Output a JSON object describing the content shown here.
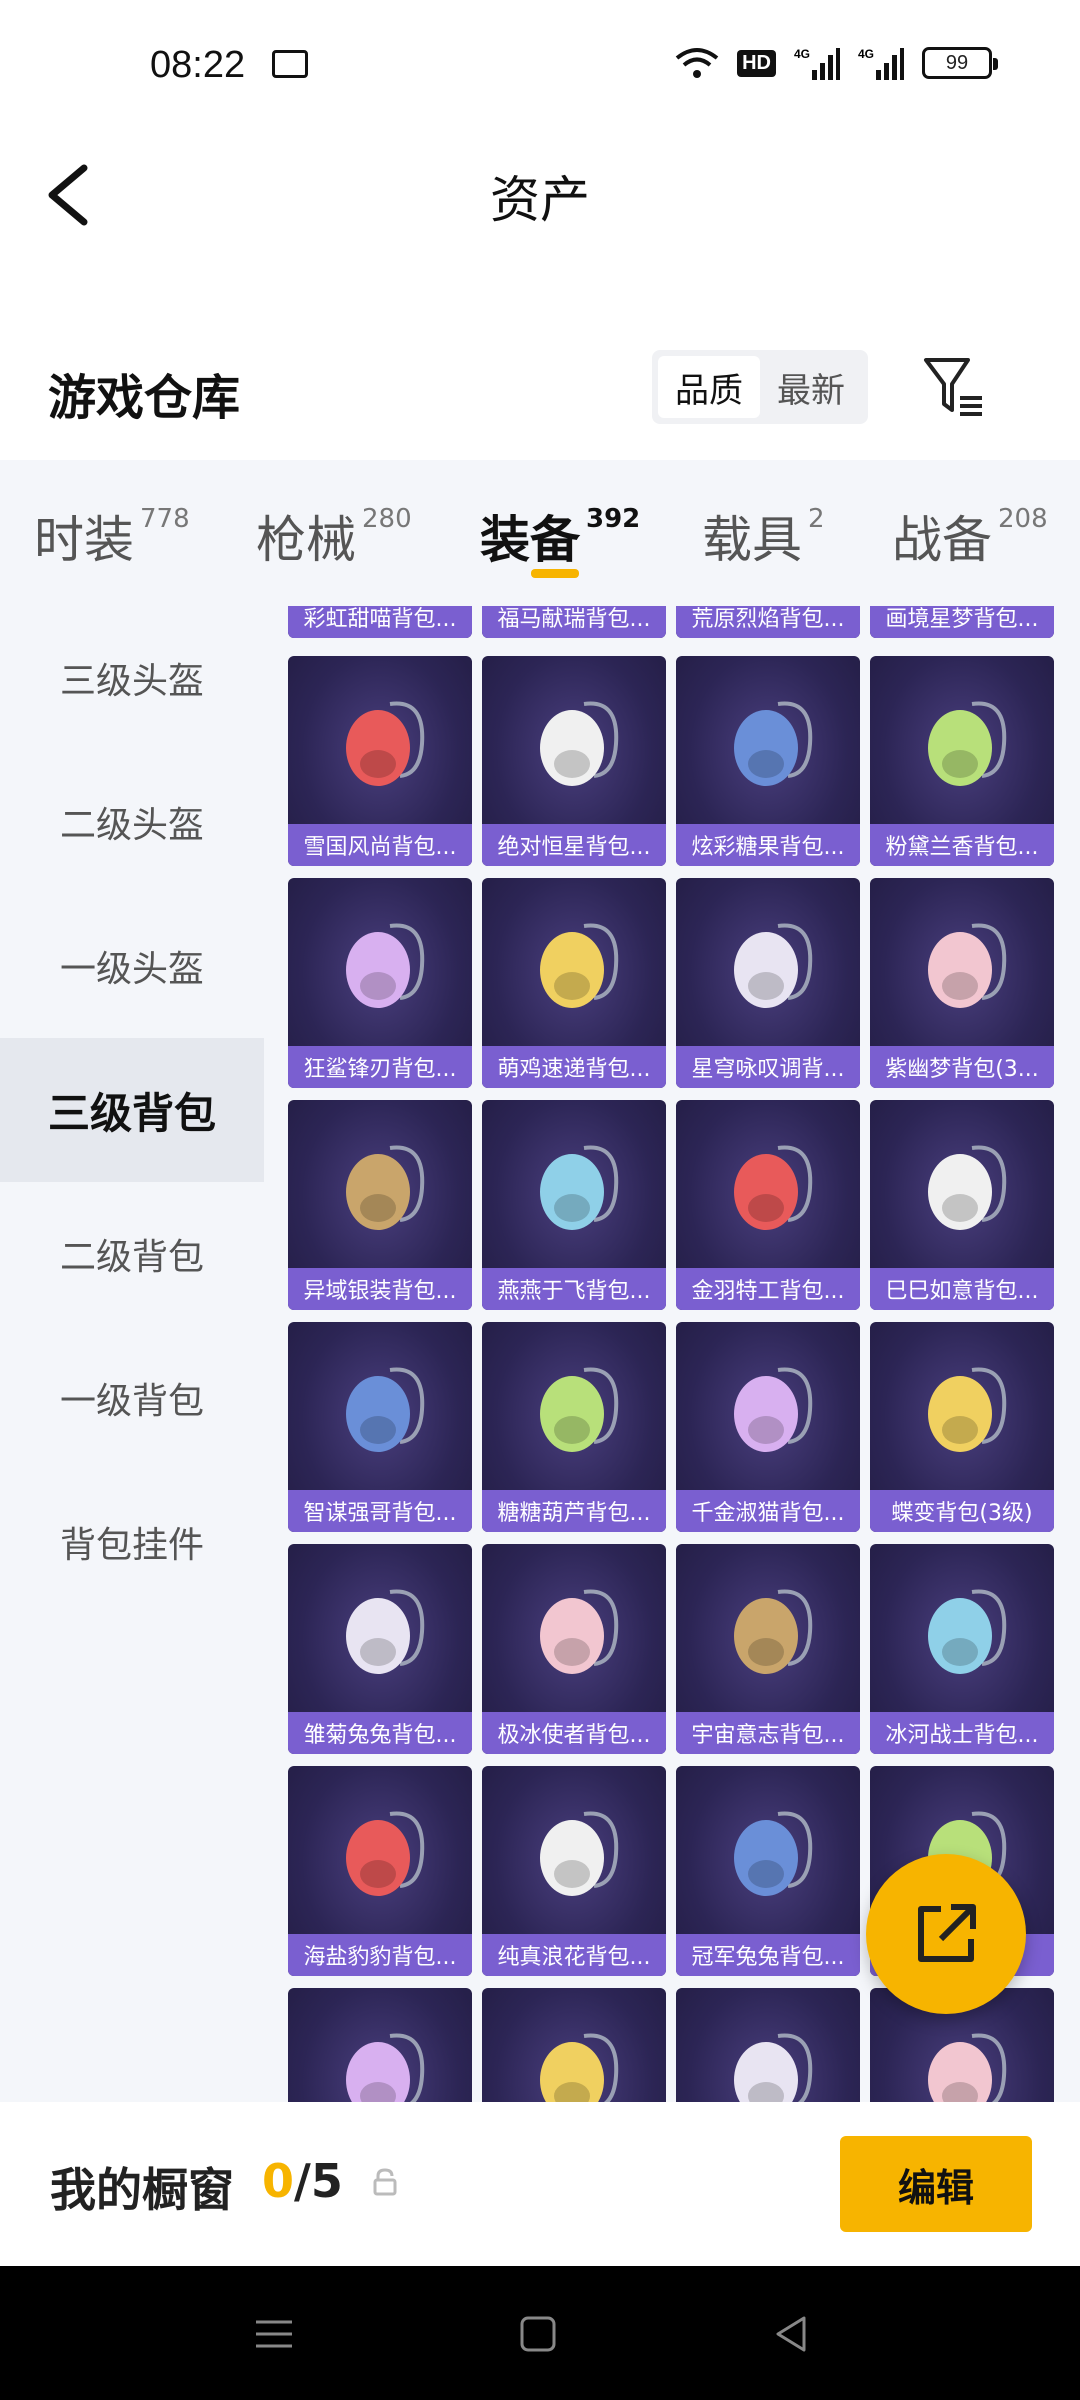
{
  "status_bar": {
    "time": "08:22",
    "hd": "HD",
    "signal1": "4G",
    "signal2": "4G",
    "battery": "99"
  },
  "header": {
    "title": "资产"
  },
  "warehouse": {
    "title": "游戏仓库",
    "sort_options": [
      "品质",
      "最新"
    ],
    "active_sort": "品质"
  },
  "tabs": [
    {
      "label": "时装",
      "count": "778"
    },
    {
      "label": "枪械",
      "count": "280"
    },
    {
      "label": "装备",
      "count": "392"
    },
    {
      "label": "载具",
      "count": "2"
    },
    {
      "label": "战备",
      "count": "208"
    }
  ],
  "active_tab": "装备",
  "sidebar": {
    "items": [
      "三级头盔",
      "二级头盔",
      "一级头盔",
      "三级背包",
      "二级背包",
      "一级背包",
      "背包挂件"
    ],
    "active": "三级背包"
  },
  "items": [
    "彩虹甜喵背包...",
    "福马献瑞背包...",
    "荒原烈焰背包...",
    "画境星梦背包...",
    "雪国风尚背包...",
    "绝对恒星背包...",
    "炫彩糖果背包...",
    "粉黛兰香背包...",
    "狂鲨锋刃背包...",
    "萌鸡速递背包...",
    "星穹咏叹调背...",
    "紫幽梦背包(3...",
    "异域银装背包...",
    "燕燕于飞背包...",
    "金羽特工背包...",
    "巳巳如意背包...",
    "智谋强哥背包...",
    "糖糖葫芦背包...",
    "千金淑猫背包...",
    "蝶变背包(3级)",
    "雏菊兔兔背包...",
    "极冰使者背包...",
    "宇宙意志背包...",
    "冰河战士背包...",
    "海盐豹豹背包...",
    "纯真浪花背包...",
    "冠军兔兔背包...",
    "...",
    "",
    "",
    "",
    ""
  ],
  "bottom": {
    "label": "我的橱窗",
    "current": "0",
    "total": "/5",
    "edit_label": "编辑"
  },
  "colors": {
    "accent": "#f7b400",
    "card_label": "#7a5fd0",
    "card_bg": "#2c2555"
  }
}
